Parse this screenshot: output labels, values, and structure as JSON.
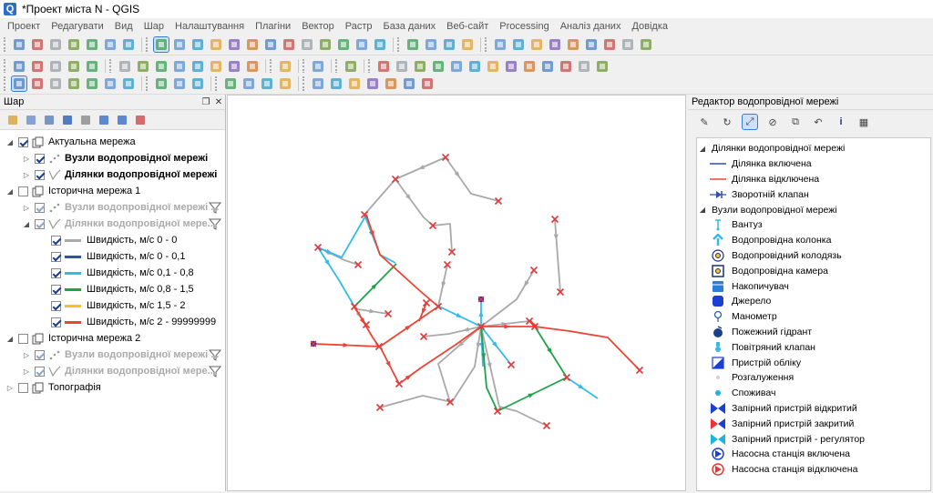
{
  "window": {
    "title": "*Проект міста N - QGIS",
    "app_icon": "Q"
  },
  "menu": [
    "Проект",
    "Редагувати",
    "Вид",
    "Шар",
    "Налаштування",
    "Плагіни",
    "Вектор",
    "Растр",
    "База даних",
    "Веб-сайт",
    "Processing",
    "Аналіз даних",
    "Довідка"
  ],
  "layers_panel": {
    "title": "Шар",
    "rows": [
      {
        "label": "Актуальна мережа",
        "kind": "group",
        "checked": true,
        "expanded": true,
        "style": "normal"
      },
      {
        "label": "Вузли водопровідної мережі",
        "kind": "point",
        "checked": true,
        "style": "bold"
      },
      {
        "label": "Ділянки водопровідної мережі",
        "kind": "line",
        "checked": true,
        "style": "bold"
      },
      {
        "label": "Історична мережа 1",
        "kind": "group",
        "checked": false,
        "expanded": true,
        "style": "normal"
      },
      {
        "label": "Вузли водопровідної мережі ...",
        "kind": "point",
        "checked": true,
        "style": "dim",
        "filtered": true
      },
      {
        "label": "Ділянки водопровідної мере...",
        "kind": "line",
        "checked": true,
        "style": "dim",
        "filtered": true,
        "expanded": true
      },
      {
        "label": "Швидкість, м/с 0 - 0",
        "kind": "legend",
        "color": "#a9a9a9"
      },
      {
        "label": "Швидкість, м/с 0 - 0,1",
        "kind": "legend",
        "color": "#2f4fb3"
      },
      {
        "label": "Швидкість, м/с 0,1 - 0,8",
        "kind": "legend",
        "color": "#33bbee"
      },
      {
        "label": "Швидкість, м/с 0,8 - 1,5",
        "kind": "legend",
        "color": "#1fa24a"
      },
      {
        "label": "Швидкість, м/с 1,5 - 2",
        "kind": "legend",
        "color": "#f5c518"
      },
      {
        "label": "Швидкість, м/с 2 - 99999999",
        "kind": "legend",
        "color": "#ee4433"
      },
      {
        "label": "Історична мережа 2",
        "kind": "group",
        "checked": false,
        "expanded": true,
        "style": "normal"
      },
      {
        "label": "Вузли водопровідної мережі ...",
        "kind": "point",
        "checked": true,
        "style": "dim",
        "filtered": true
      },
      {
        "label": "Ділянки водопровідної мере...",
        "kind": "line",
        "checked": true,
        "style": "dim",
        "filtered": true
      },
      {
        "label": "Топографія",
        "kind": "group",
        "checked": false,
        "expanded": false,
        "style": "normal"
      }
    ]
  },
  "editor_panel": {
    "title": "Редактор водопровідної мережі",
    "sections": [
      {
        "label": "Ділянки водопровідної мережі",
        "items": [
          {
            "label": "Ділянка включена",
            "icon": "line-blue-icon"
          },
          {
            "label": "Ділянка відключена",
            "icon": "line-red-icon"
          },
          {
            "label": "Зворотній клапан",
            "icon": "check-valve-icon"
          }
        ]
      },
      {
        "label": "Вузли водопровідної мережі",
        "items": [
          {
            "label": "Вантуз",
            "icon": "air-valve-icon"
          },
          {
            "label": "Водопровідна колонка",
            "icon": "standpipe-icon"
          },
          {
            "label": "Водопровідний колодязь",
            "icon": "well-icon"
          },
          {
            "label": "Водопровідна камера",
            "icon": "chamber-icon"
          },
          {
            "label": "Накопичувач",
            "icon": "storage-icon"
          },
          {
            "label": "Джерело",
            "icon": "source-icon"
          },
          {
            "label": "Манометр",
            "icon": "manometer-icon"
          },
          {
            "label": "Пожежний гідрант",
            "icon": "hydrant-icon"
          },
          {
            "label": "Повітряний клапан",
            "icon": "air-release-icon"
          },
          {
            "label": "Пристрій обліку",
            "icon": "meter-icon"
          },
          {
            "label": "Розгалуження",
            "icon": "junction-icon"
          },
          {
            "label": "Споживач",
            "icon": "consumer-icon"
          },
          {
            "label": "Запірний пристрій відкритий",
            "icon": "valve-open-icon"
          },
          {
            "label": "Запірний пристрій закритий",
            "icon": "valve-closed-icon"
          },
          {
            "label": "Запірний пристрій - регулятор",
            "icon": "valve-regulator-icon"
          },
          {
            "label": "Насосна станція включена",
            "icon": "pump-on-icon"
          },
          {
            "label": "Насосна станція відключена",
            "icon": "pump-off-icon"
          }
        ]
      }
    ]
  },
  "colors": {
    "gray": "#a9a9a9",
    "blue": "#33bbee",
    "green": "#1fa24a",
    "red": "#ee4433",
    "node": "#e23a3a",
    "source": "#3a2ab0"
  }
}
